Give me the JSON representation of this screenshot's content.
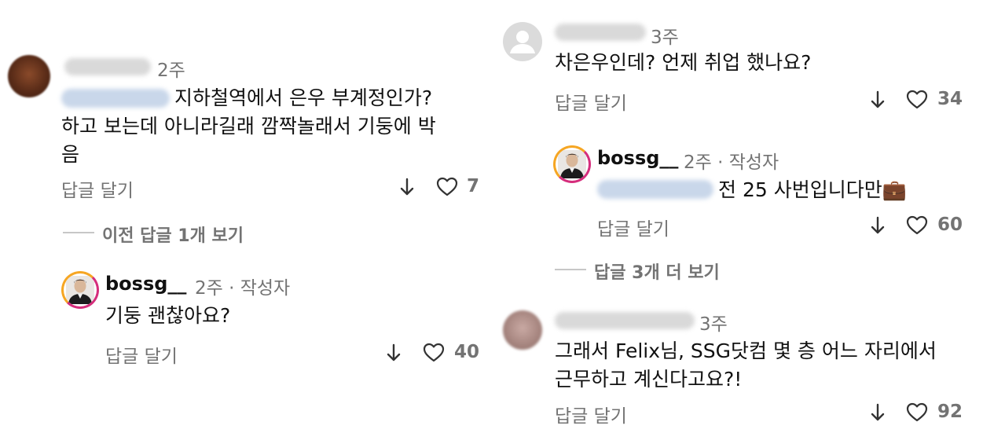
{
  "left": {
    "comment1": {
      "time": "2주",
      "line1": "지하철역에서 은우 부계정인가?",
      "line2": "하고 보는데 아니라길래 깜짝놀래서 기둥에 박",
      "line3": "음",
      "reply_label": "답글 달기",
      "likes": "7"
    },
    "view_previous": "이전 답글 1개 보기",
    "reply1": {
      "username": "bossg__",
      "meta": "2주 · 작성자",
      "text": "기둥 괜찮아요?",
      "reply_label": "답글 달기",
      "likes": "40"
    }
  },
  "right": {
    "comment2": {
      "time": "3주",
      "text": "차은우인데? 언제 취업 했나요?",
      "reply_label": "답글 달기",
      "likes": "34"
    },
    "reply2": {
      "username": "bossg__",
      "meta": "2주 · 작성자",
      "text": "전 25 사번입니다만",
      "emoji": "💼",
      "reply_label": "답글 달기",
      "likes": "60"
    },
    "view_more": "답글 3개 더 보기",
    "comment3": {
      "time": "3주",
      "line1": "그래서 Felix님, SSG닷컴 몇 층 어느 자리에서",
      "line2": "근무하고 계신다고요?!",
      "reply_label": "답글 달기",
      "likes": "92"
    }
  },
  "colors": {
    "meta_gray": "#737373",
    "story_ring": "#d52d7c"
  }
}
